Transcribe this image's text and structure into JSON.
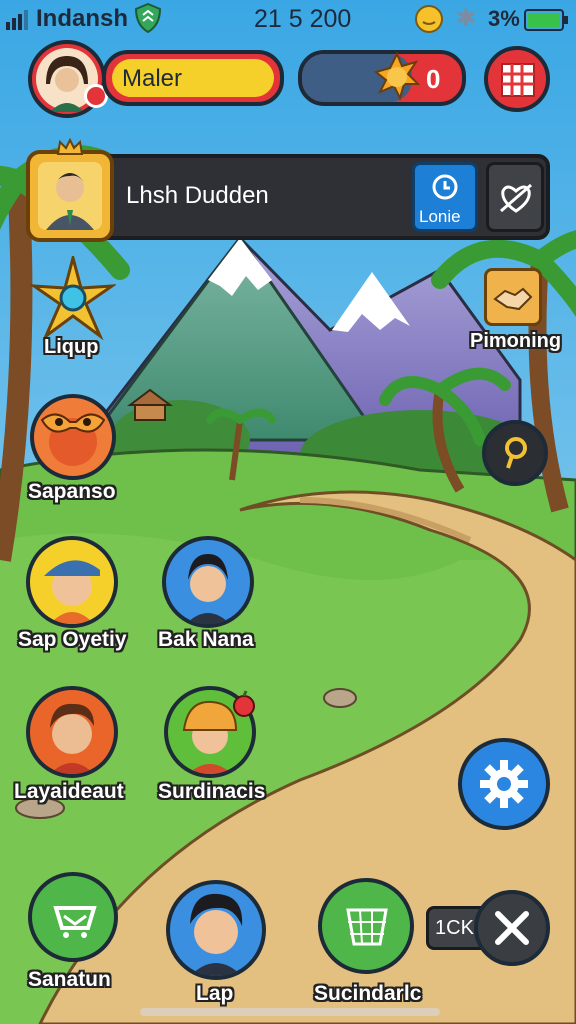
{
  "status_bar": {
    "carrier": "Indansh",
    "time": "21 5 200",
    "battery": "3%"
  },
  "top_bar": {
    "player_name": "Maler",
    "currency_value": "0"
  },
  "profile_banner": {
    "name": "Lhsh Dudden",
    "action_label": "Lonie"
  },
  "map_nodes": [
    {
      "label": "Liqup"
    },
    {
      "label": "Pimoning"
    },
    {
      "label": "Sapanso"
    }
  ],
  "characters": [
    {
      "label": "Sap Oyetiy"
    },
    {
      "label": "Bak Nana"
    },
    {
      "label": "Layaideaut"
    },
    {
      "label": "Surdinacis"
    }
  ],
  "bottom_bar": {
    "left_label": "Sanatun",
    "center_label": "Lap",
    "right_label": "Sucindarlc",
    "close_tag": "1CK"
  },
  "colors": {
    "sky": "#4fb6e8",
    "grass": "#6fc04a",
    "path": "#e3bf80",
    "accent_red": "#e3343a",
    "accent_blue": "#2a86e0",
    "accent_yellow": "#f6d02a"
  }
}
